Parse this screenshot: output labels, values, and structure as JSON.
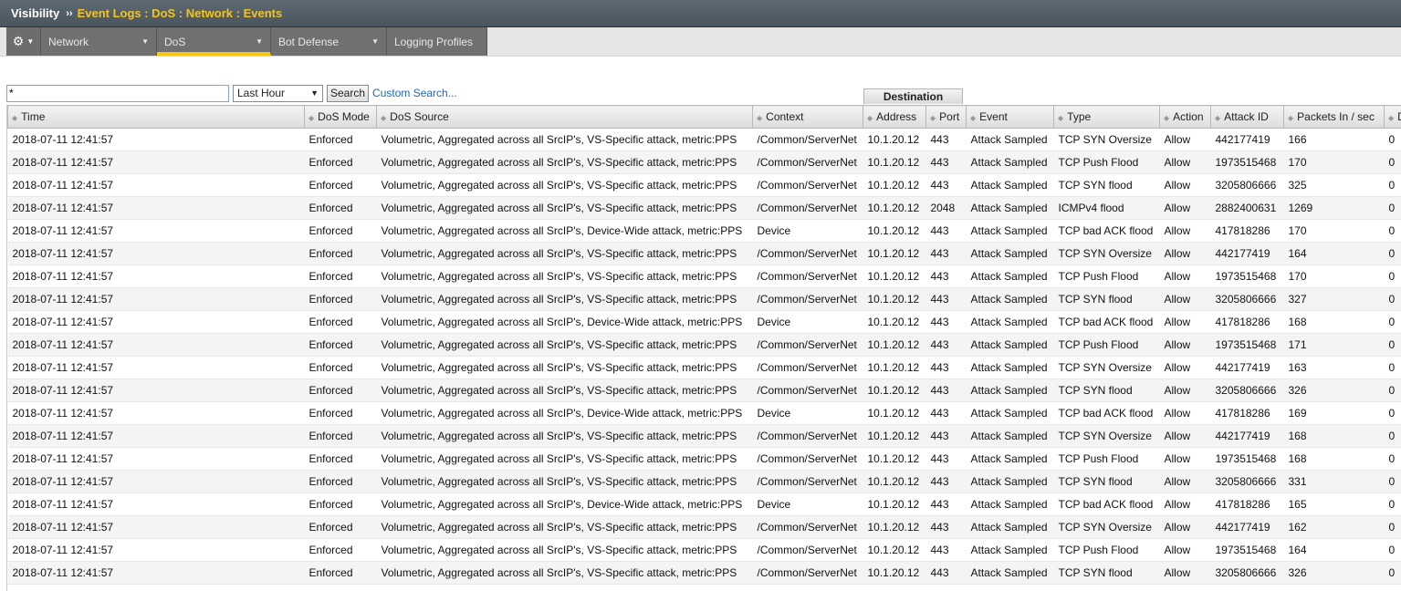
{
  "titlebar": {
    "root": "Visibility",
    "separator": "››",
    "breadcrumb": "Event Logs : DoS : Network : Events"
  },
  "menu": {
    "gear_icon": "gear-icon",
    "tabs": [
      {
        "label": "Network",
        "has_dropdown": true,
        "active": false
      },
      {
        "label": "DoS",
        "has_dropdown": true,
        "active": true
      },
      {
        "label": "Bot Defense",
        "has_dropdown": true,
        "active": false
      },
      {
        "label": "Logging Profiles",
        "has_dropdown": false,
        "active": false
      }
    ]
  },
  "filter": {
    "search_value": "*",
    "range_selected": "Last Hour",
    "search_label": "Search",
    "custom_search_label": "Custom Search..."
  },
  "grid": {
    "group_header": "Destination",
    "columns": [
      "Time",
      "DoS Mode",
      "DoS Source",
      "Context",
      "Address",
      "Port",
      "Event",
      "Type",
      "Action",
      "Attack ID",
      "Packets In / sec",
      "D"
    ],
    "rows": [
      [
        "2018-07-11 12:41:57",
        "Enforced",
        "Volumetric, Aggregated across all SrcIP's, VS-Specific attack, metric:PPS",
        "/Common/ServerNet",
        "10.1.20.12",
        "443",
        "Attack Sampled",
        "TCP SYN Oversize",
        "Allow",
        "442177419",
        "166",
        "0"
      ],
      [
        "2018-07-11 12:41:57",
        "Enforced",
        "Volumetric, Aggregated across all SrcIP's, VS-Specific attack, metric:PPS",
        "/Common/ServerNet",
        "10.1.20.12",
        "443",
        "Attack Sampled",
        "TCP Push Flood",
        "Allow",
        "1973515468",
        "170",
        "0"
      ],
      [
        "2018-07-11 12:41:57",
        "Enforced",
        "Volumetric, Aggregated across all SrcIP's, VS-Specific attack, metric:PPS",
        "/Common/ServerNet",
        "10.1.20.12",
        "443",
        "Attack Sampled",
        "TCP SYN flood",
        "Allow",
        "3205806666",
        "325",
        "0"
      ],
      [
        "2018-07-11 12:41:57",
        "Enforced",
        "Volumetric, Aggregated across all SrcIP's, VS-Specific attack, metric:PPS",
        "/Common/ServerNet",
        "10.1.20.12",
        "2048",
        "Attack Sampled",
        "ICMPv4 flood",
        "Allow",
        "2882400631",
        "1269",
        "0"
      ],
      [
        "2018-07-11 12:41:57",
        "Enforced",
        "Volumetric, Aggregated across all SrcIP's, Device-Wide attack, metric:PPS",
        "Device",
        "10.1.20.12",
        "443",
        "Attack Sampled",
        "TCP bad ACK flood",
        "Allow",
        "417818286",
        "170",
        "0"
      ],
      [
        "2018-07-11 12:41:57",
        "Enforced",
        "Volumetric, Aggregated across all SrcIP's, VS-Specific attack, metric:PPS",
        "/Common/ServerNet",
        "10.1.20.12",
        "443",
        "Attack Sampled",
        "TCP SYN Oversize",
        "Allow",
        "442177419",
        "164",
        "0"
      ],
      [
        "2018-07-11 12:41:57",
        "Enforced",
        "Volumetric, Aggregated across all SrcIP's, VS-Specific attack, metric:PPS",
        "/Common/ServerNet",
        "10.1.20.12",
        "443",
        "Attack Sampled",
        "TCP Push Flood",
        "Allow",
        "1973515468",
        "170",
        "0"
      ],
      [
        "2018-07-11 12:41:57",
        "Enforced",
        "Volumetric, Aggregated across all SrcIP's, VS-Specific attack, metric:PPS",
        "/Common/ServerNet",
        "10.1.20.12",
        "443",
        "Attack Sampled",
        "TCP SYN flood",
        "Allow",
        "3205806666",
        "327",
        "0"
      ],
      [
        "2018-07-11 12:41:57",
        "Enforced",
        "Volumetric, Aggregated across all SrcIP's, Device-Wide attack, metric:PPS",
        "Device",
        "10.1.20.12",
        "443",
        "Attack Sampled",
        "TCP bad ACK flood",
        "Allow",
        "417818286",
        "168",
        "0"
      ],
      [
        "2018-07-11 12:41:57",
        "Enforced",
        "Volumetric, Aggregated across all SrcIP's, VS-Specific attack, metric:PPS",
        "/Common/ServerNet",
        "10.1.20.12",
        "443",
        "Attack Sampled",
        "TCP Push Flood",
        "Allow",
        "1973515468",
        "171",
        "0"
      ],
      [
        "2018-07-11 12:41:57",
        "Enforced",
        "Volumetric, Aggregated across all SrcIP's, VS-Specific attack, metric:PPS",
        "/Common/ServerNet",
        "10.1.20.12",
        "443",
        "Attack Sampled",
        "TCP SYN Oversize",
        "Allow",
        "442177419",
        "163",
        "0"
      ],
      [
        "2018-07-11 12:41:57",
        "Enforced",
        "Volumetric, Aggregated across all SrcIP's, VS-Specific attack, metric:PPS",
        "/Common/ServerNet",
        "10.1.20.12",
        "443",
        "Attack Sampled",
        "TCP SYN flood",
        "Allow",
        "3205806666",
        "326",
        "0"
      ],
      [
        "2018-07-11 12:41:57",
        "Enforced",
        "Volumetric, Aggregated across all SrcIP's, Device-Wide attack, metric:PPS",
        "Device",
        "10.1.20.12",
        "443",
        "Attack Sampled",
        "TCP bad ACK flood",
        "Allow",
        "417818286",
        "169",
        "0"
      ],
      [
        "2018-07-11 12:41:57",
        "Enforced",
        "Volumetric, Aggregated across all SrcIP's, VS-Specific attack, metric:PPS",
        "/Common/ServerNet",
        "10.1.20.12",
        "443",
        "Attack Sampled",
        "TCP SYN Oversize",
        "Allow",
        "442177419",
        "168",
        "0"
      ],
      [
        "2018-07-11 12:41:57",
        "Enforced",
        "Volumetric, Aggregated across all SrcIP's, VS-Specific attack, metric:PPS",
        "/Common/ServerNet",
        "10.1.20.12",
        "443",
        "Attack Sampled",
        "TCP Push Flood",
        "Allow",
        "1973515468",
        "168",
        "0"
      ],
      [
        "2018-07-11 12:41:57",
        "Enforced",
        "Volumetric, Aggregated across all SrcIP's, VS-Specific attack, metric:PPS",
        "/Common/ServerNet",
        "10.1.20.12",
        "443",
        "Attack Sampled",
        "TCP SYN flood",
        "Allow",
        "3205806666",
        "331",
        "0"
      ],
      [
        "2018-07-11 12:41:57",
        "Enforced",
        "Volumetric, Aggregated across all SrcIP's, Device-Wide attack, metric:PPS",
        "Device",
        "10.1.20.12",
        "443",
        "Attack Sampled",
        "TCP bad ACK flood",
        "Allow",
        "417818286",
        "165",
        "0"
      ],
      [
        "2018-07-11 12:41:57",
        "Enforced",
        "Volumetric, Aggregated across all SrcIP's, VS-Specific attack, metric:PPS",
        "/Common/ServerNet",
        "10.1.20.12",
        "443",
        "Attack Sampled",
        "TCP SYN Oversize",
        "Allow",
        "442177419",
        "162",
        "0"
      ],
      [
        "2018-07-11 12:41:57",
        "Enforced",
        "Volumetric, Aggregated across all SrcIP's, VS-Specific attack, metric:PPS",
        "/Common/ServerNet",
        "10.1.20.12",
        "443",
        "Attack Sampled",
        "TCP Push Flood",
        "Allow",
        "1973515468",
        "164",
        "0"
      ],
      [
        "2018-07-11 12:41:57",
        "Enforced",
        "Volumetric, Aggregated across all SrcIP's, VS-Specific attack, metric:PPS",
        "/Common/ServerNet",
        "10.1.20.12",
        "443",
        "Attack Sampled",
        "TCP SYN flood",
        "Allow",
        "3205806666",
        "326",
        "0"
      ]
    ]
  }
}
